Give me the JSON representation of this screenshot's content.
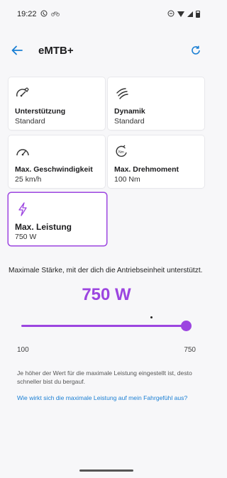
{
  "status_bar": {
    "time": "19:22"
  },
  "app_bar": {
    "title": "eMTB+"
  },
  "cards": [
    {
      "title": "Unterstützung",
      "value": "Standard",
      "icon": "speedometer-wrench-icon"
    },
    {
      "title": "Dynamik",
      "value": "Standard",
      "icon": "dynamics-icon"
    },
    {
      "title": "Max. Geschwindigkeit",
      "value": "25 km/h",
      "icon": "gauge-icon"
    },
    {
      "title": "Max. Drehmoment",
      "value": "100 Nm",
      "icon": "torque-icon"
    },
    {
      "title": "Max. Leistung",
      "value": "750 W",
      "icon": "lightning-icon"
    }
  ],
  "description": "Maximale Stärke, mit der dich die Antriebseinheit unterstützt.",
  "power": {
    "value_text": "750 W",
    "min": 100,
    "max": 750,
    "current": 750,
    "min_label": "100",
    "max_label": "750"
  },
  "hint": "Je höher der Wert für die maximale Leistung eingestellt ist, desto schneller bist du bergauf.",
  "link": "Wie wirkt sich die maximale Leistung auf mein Fahrgefühl aus?",
  "colors": {
    "accent": "#9c45e0",
    "link": "#1a7fd4",
    "back_arrow": "#1a7fd4"
  }
}
